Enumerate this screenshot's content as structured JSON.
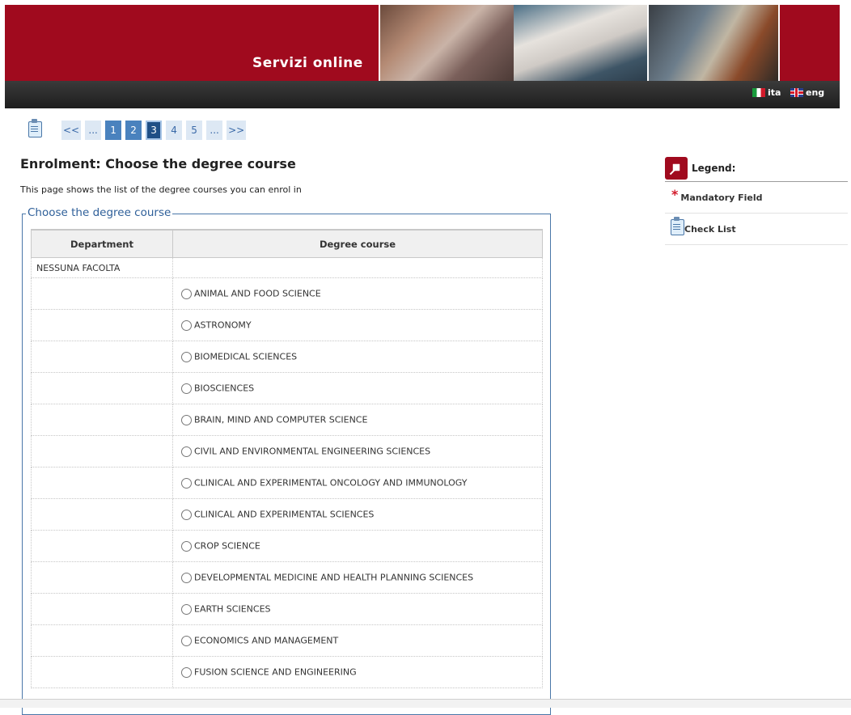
{
  "header": {
    "title": "Servizi online",
    "brand_color": "#a00a1e",
    "languages": [
      {
        "code": "ita",
        "label": "ita"
      },
      {
        "code": "eng",
        "label": "eng"
      }
    ]
  },
  "pager": {
    "items": [
      "<<",
      "...",
      "1",
      "2",
      "3",
      "4",
      "5",
      "...",
      ">>"
    ],
    "current": "3"
  },
  "page": {
    "title": "Enrolment: Choose the degree course",
    "intro": "This page shows the list of the degree courses you can enrol in"
  },
  "form": {
    "legend": "Choose the degree course",
    "columns": [
      "Department",
      "Degree course"
    ],
    "department": "NESSUNA FACOLTA",
    "courses": [
      "ANIMAL AND FOOD SCIENCE",
      "ASTRONOMY",
      "BIOMEDICAL SCIENCES",
      "BIOSCIENCES",
      "BRAIN, MIND AND COMPUTER SCIENCE",
      "CIVIL AND ENVIRONMENTAL ENGINEERING SCIENCES",
      "CLINICAL AND EXPERIMENTAL ONCOLOGY AND IMMUNOLOGY",
      "CLINICAL AND EXPERIMENTAL SCIENCES",
      "CROP SCIENCE",
      "DEVELOPMENTAL MEDICINE AND HEALTH PLANNING SCIENCES",
      "EARTH SCIENCES",
      "ECONOMICS AND MANAGEMENT",
      "FUSION SCIENCE AND ENGINEERING"
    ]
  },
  "legend_panel": {
    "title": "Legend:",
    "items": [
      {
        "icon": "asterisk-icon",
        "label": "Mandatory Field"
      },
      {
        "icon": "checklist-icon",
        "label": "Check List"
      }
    ]
  }
}
